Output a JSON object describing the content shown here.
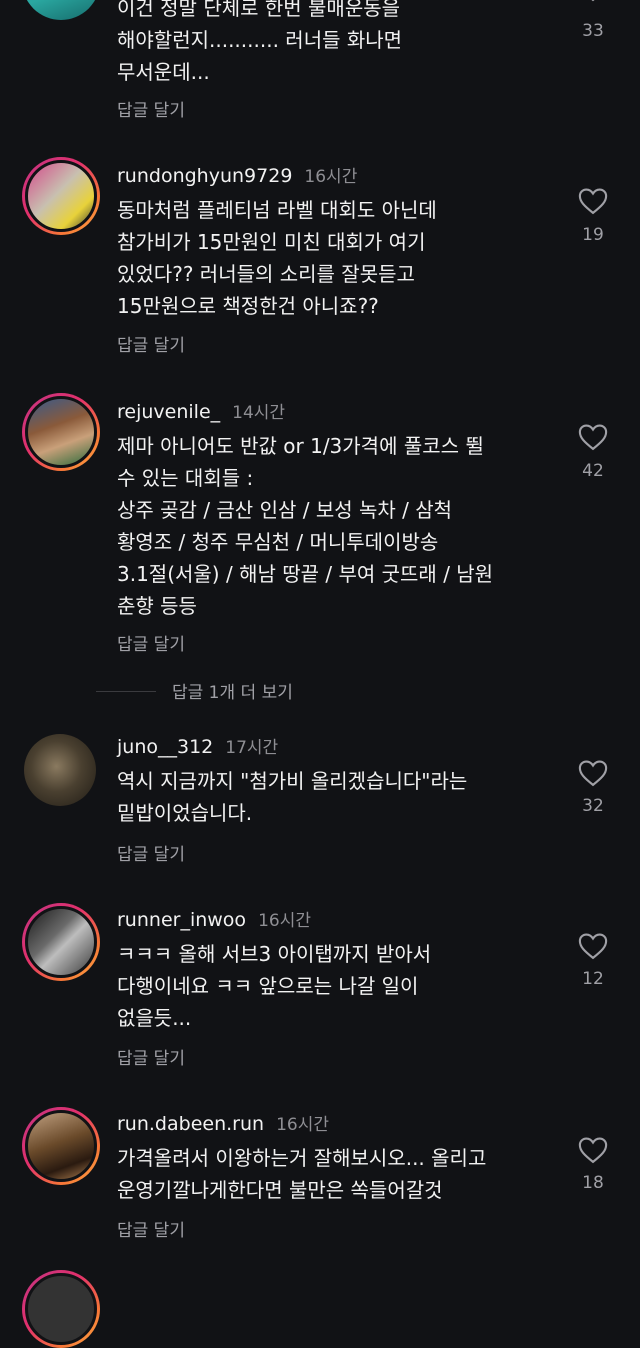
{
  "comments": [
    {
      "username": "",
      "time": "",
      "text": "이건 정말 단체로 한번 불매운동을\n해야할런지........... 러너들 화나면\n무서운데...",
      "reply": "답글 달기",
      "likes": "33",
      "ring": false,
      "avatar_colors": [
        "#1f8a8a",
        "#2aa7a0"
      ]
    },
    {
      "username": "rundonghyun9729",
      "time": "16시간",
      "text": "동마처럼 플레티넘 라벨 대회도 아닌데\n참가비가 15만원인 미친 대회가 여기\n있었다?? 러너들의 소리를 잘못듣고\n15만원으로 책정한건 아니죠??",
      "reply": "답글 달기",
      "likes": "19",
      "ring": true,
      "avatar_colors": [
        "#d44b8a",
        "#e8d23a"
      ]
    },
    {
      "username": "rejuvenile_",
      "time": "14시간",
      "text": "제마 아니어도 반값 or 1/3가격에 풀코스 뛸\n수 있는 대회들 :\n상주 곶감 / 금산 인삼 /  보성 녹차 / 삼척\n황영조 / 청주 무심천 / 머니투데이방송\n3.1절(서울) / 해남 땅끝 / 부여 굿뜨래 / 남원\n춘향 등등",
      "reply": "답글 달기",
      "likes": "42",
      "ring": true,
      "avatar_colors": [
        "#8a5a3a",
        "#c9a07a"
      ]
    },
    {
      "username": "juno__312",
      "time": "17시간",
      "text": "역시 지금까지 \"첨가비 올리겠습니다\"라는\n밑밥이었습니다.",
      "reply": "답글 달기",
      "likes": "32",
      "ring": false,
      "avatar_colors": [
        "#4a4030",
        "#7a6a50"
      ]
    },
    {
      "username": "runner_inwoo",
      "time": "16시간",
      "text": "ㅋㅋㅋ 올해 서브3 아이탭까지 받아서\n다행이네요 ㅋㅋ 앞으로는 나갈 일이\n없을듯...",
      "reply": "답글 달기",
      "likes": "12",
      "ring": true,
      "avatar_colors": [
        "#2a2a2a",
        "#8a8a8a"
      ]
    },
    {
      "username": "run.dabeen.run",
      "time": "16시간",
      "text": "가격올려서 이왕하는거 잘해보시오... 올리고\n운영기깔나게한다면 불만은 쏙들어갈것",
      "reply": "답글 달기",
      "likes": "18",
      "ring": true,
      "avatar_colors": [
        "#6a4a2a",
        "#b08050"
      ]
    }
  ],
  "more_replies": "답글 1개 더 보기"
}
